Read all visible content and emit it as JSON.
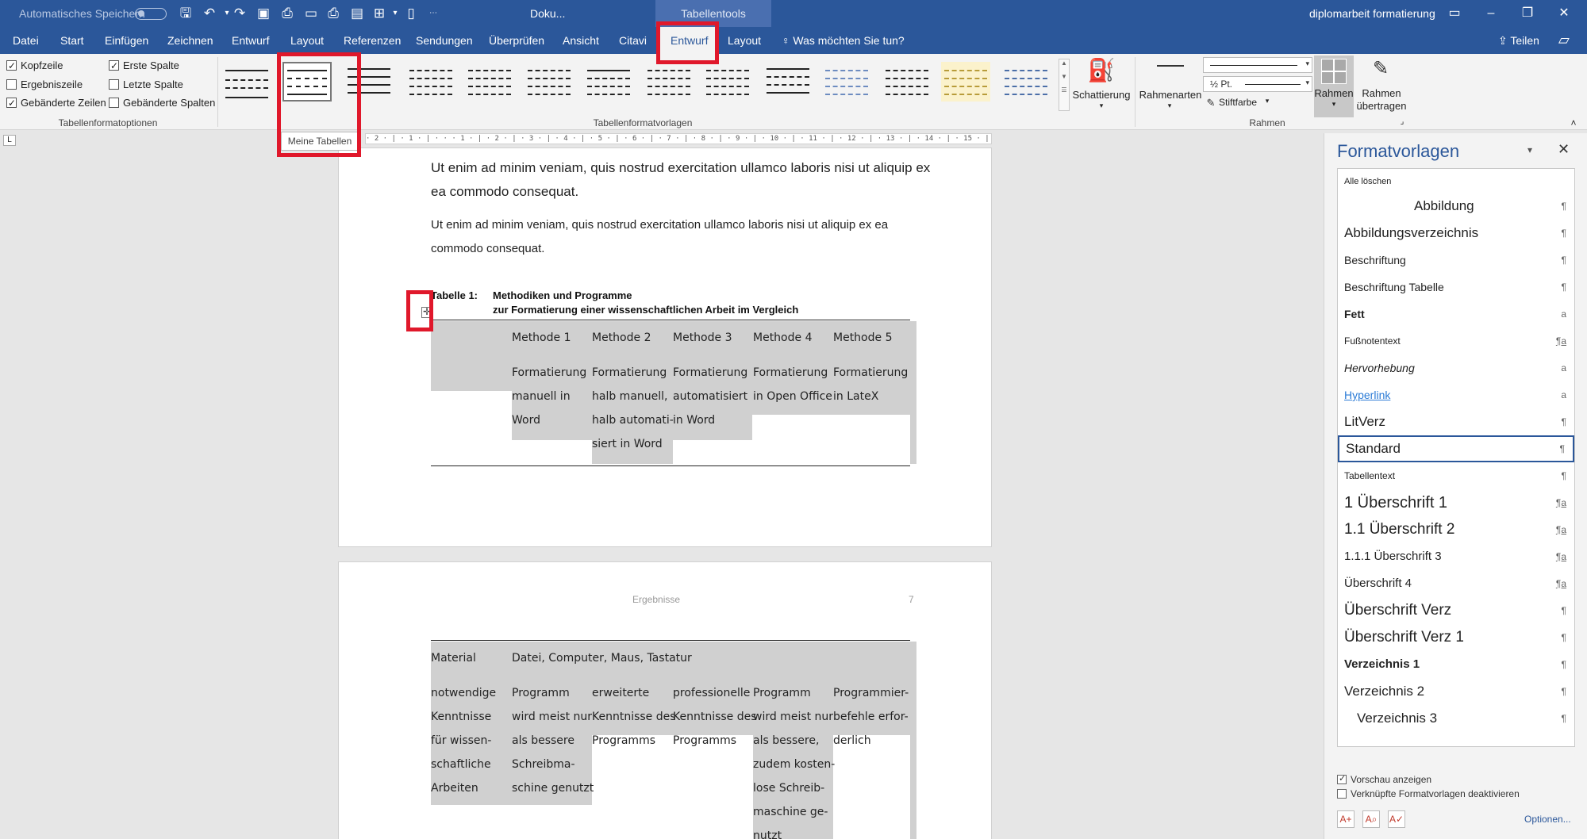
{
  "titlebar": {
    "autosave": "Automatisches Speichern",
    "doc_title": "Doku...",
    "context_tools": "Tabellentools",
    "filename": "diplomarbeit formatierung"
  },
  "tabs": {
    "items": [
      "Datei",
      "Start",
      "Einfügen",
      "Zeichnen",
      "Entwurf",
      "Layout",
      "Referenzen",
      "Sendungen",
      "Überprüfen",
      "Ansicht",
      "Citavi",
      "Entwurf",
      "Layout"
    ],
    "tell_me": "Was möchten Sie tun?",
    "share": "Teilen"
  },
  "ribbon": {
    "options": {
      "kopfzeile": "Kopfzeile",
      "ergebniszeile": "Ergebniszeile",
      "gebaenderte_zeilen": "Gebänderte Zeilen",
      "erste_spalte": "Erste Spalte",
      "letzte_spalte": "Letzte Spalte",
      "gebaenderte_spalten": "Gebänderte Spalten"
    },
    "group_options": "Tabellenformatoptionen",
    "group_styles": "Tabellenformatvorlagen",
    "group_borders": "Rahmen",
    "shading": "Schattierung",
    "border_styles": "Rahmenarten",
    "pen_weight": "½ Pt.",
    "pen_color": "Stiftfarbe",
    "borders": "Rahmen",
    "border_painter_1": "Rahmen",
    "border_painter_2": "übertragen",
    "tooltip": "Meine Tabellen"
  },
  "ruler": {
    "text": "· 2 · | · 1 · | · · · 1 · | · 2 · | · 3 · | · 4 · | · 5 · | · 6 · | · 7 · | · 8 · | · 9 · | · 10 · | · 11 · | · 12 · | · 13 · | · 14 · | · 15 · | · 16 · | · 17 · |"
  },
  "page1": {
    "para1": "Ut enim ad minim veniam, quis nostrud exercitation ullamco laboris nisi ut aliquip ex ea commodo consequat.",
    "para2": "Ut enim ad minim veniam, quis nostrud exercitation ullamco laboris nisi ut aliquip ex ea commodo consequat.",
    "caption_label": "Tabelle 1:",
    "caption_line1": "Methodiken und Programme",
    "caption_line2": "zur Formatierung einer wissenschaftlichen Arbeit im Vergleich",
    "table": {
      "headers": [
        "Methode 1",
        "Methode 2",
        "Methode 3",
        "Methode 4",
        "Methode 5"
      ],
      "row": [
        [
          "Formatierung",
          "manuell in",
          "Word"
        ],
        [
          "Formatierung",
          "halb manuell,",
          "halb automati-",
          "siert in Word"
        ],
        [
          "Formatierung",
          "automatisiert",
          "in Word"
        ],
        [
          "Formatierung",
          "in Open Office"
        ],
        [
          "Formatierung",
          "in LateX"
        ]
      ]
    }
  },
  "page2": {
    "header_center": "Ergebnisse",
    "header_right": "7",
    "row1_label": "Material",
    "row1_value": "Datei, Computer, Maus, Tastatur",
    "row2": [
      [
        "notwendige",
        "Kenntnisse",
        "für wissen-",
        "schaftliche",
        "Arbeiten"
      ],
      [
        "Programm",
        "wird meist nur",
        "als bessere",
        "Schreibma-",
        "schine genutzt"
      ],
      [
        "erweiterte",
        "Kenntnisse des",
        "Programms"
      ],
      [
        "professionelle",
        "Kenntnisse des",
        "Programms"
      ],
      [
        "Programm",
        "wird meist nur",
        "als bessere,",
        "zudem kosten-",
        "lose Schreib-",
        "maschine ge-",
        "nutzt"
      ],
      [
        "Programmier-",
        "befehle erfor-",
        "derlich"
      ]
    ]
  },
  "pane": {
    "title": "Formatvorlagen",
    "styles": [
      {
        "name": "Alle löschen",
        "mark": ""
      },
      {
        "name": "Abbildung",
        "mark": "¶"
      },
      {
        "name": "Abbildungsverzeichnis",
        "mark": "¶"
      },
      {
        "name": "Beschriftung",
        "mark": "¶"
      },
      {
        "name": "Beschriftung Tabelle",
        "mark": "¶"
      },
      {
        "name": "Fett",
        "mark": "a"
      },
      {
        "name": "Fußnotentext",
        "mark": "¶a"
      },
      {
        "name": "Hervorhebung",
        "mark": "a"
      },
      {
        "name": "Hyperlink",
        "mark": "a"
      },
      {
        "name": "LitVerz",
        "mark": "¶"
      },
      {
        "name": "Standard",
        "mark": "¶"
      },
      {
        "name": "Tabellentext",
        "mark": "¶"
      },
      {
        "name": "1  Überschrift 1",
        "mark": "¶a"
      },
      {
        "name": "1.1  Überschrift 2",
        "mark": "¶a"
      },
      {
        "name": "1.1.1  Überschrift 3",
        "mark": "¶a"
      },
      {
        "name": "Überschrift 4",
        "mark": "¶a"
      },
      {
        "name": "Überschrift Verz",
        "mark": "¶"
      },
      {
        "name": "Überschrift Verz 1",
        "mark": "¶"
      },
      {
        "name": "Verzeichnis 1",
        "mark": "¶"
      },
      {
        "name": "Verzeichnis 2",
        "mark": "¶"
      },
      {
        "name": "Verzeichnis 3",
        "mark": "¶"
      }
    ],
    "preview": "Vorschau anzeigen",
    "linked": "Verknüpfte Formatvorlagen deaktivieren",
    "options": "Optionen..."
  },
  "colors": {
    "brand": "#2b579a",
    "highlight": "#e0182b",
    "table_shade": "#d0d0d0"
  }
}
